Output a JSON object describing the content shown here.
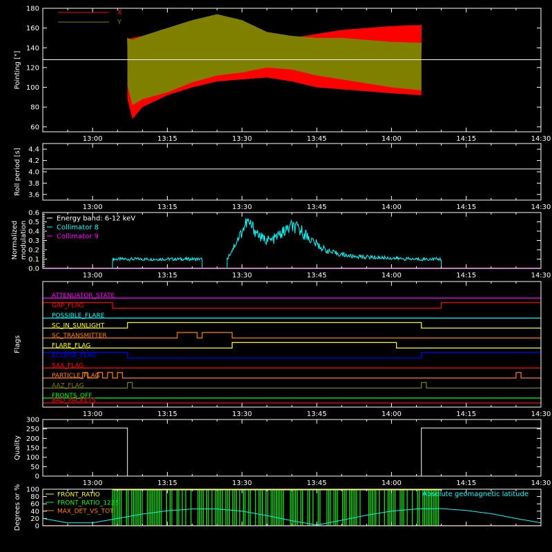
{
  "colors": {
    "background": "#000000",
    "axis": "#ffffff",
    "x_series": "#ff0000",
    "y_series": "#808000",
    "collimator8": "#00ffff",
    "collimator9": "#ff00ff",
    "green": "#00ff00",
    "yellow": "#ffff00",
    "orange": "#ff8000"
  },
  "chart_data": [
    {
      "id": "pointing",
      "type": "line",
      "ylabel": "Pointing [\"]",
      "xlim": [
        "12:50",
        "14:30"
      ],
      "ylim": [
        55,
        180
      ],
      "yticks": [
        60,
        80,
        100,
        120,
        140,
        160,
        180
      ],
      "xticks": [
        "13:00",
        "13:15",
        "13:30",
        "13:45",
        "14:00",
        "14:15",
        "14:30"
      ],
      "legend": [
        "X",
        "Y"
      ],
      "reference_line": 128,
      "series": [
        {
          "name": "X",
          "color": "#ff0000",
          "x": [
            "13:07",
            "13:08",
            "13:10",
            "13:15",
            "13:20",
            "13:25",
            "13:30",
            "13:35",
            "13:40",
            "13:45",
            "13:50",
            "13:55",
            "14:00",
            "14:06"
          ],
          "upper": [
            148,
            150,
            152,
            160,
            165,
            168,
            160,
            152,
            150,
            154,
            158,
            160,
            162,
            163
          ],
          "lower": [
            88,
            68,
            80,
            92,
            100,
            106,
            108,
            110,
            106,
            100,
            98,
            96,
            94,
            92
          ]
        },
        {
          "name": "Y",
          "color": "#808000",
          "x": [
            "13:07",
            "13:08",
            "13:10",
            "13:15",
            "13:20",
            "13:25",
            "13:30",
            "13:35",
            "13:40",
            "13:45",
            "13:50",
            "13:55",
            "14:00",
            "14:06"
          ],
          "upper": [
            150,
            148,
            152,
            160,
            168,
            174,
            168,
            156,
            152,
            150,
            150,
            148,
            146,
            145
          ],
          "lower": [
            102,
            82,
            88,
            95,
            105,
            112,
            115,
            120,
            118,
            112,
            108,
            104,
            100,
            97
          ]
        }
      ]
    },
    {
      "id": "roll",
      "type": "line",
      "ylabel": "Roll period [s]",
      "ylim": [
        3.5,
        4.5
      ],
      "yticks": [
        3.6,
        3.8,
        4.0,
        4.2,
        4.4
      ],
      "yticklabels": [
        "3.6",
        "3.8",
        "4.0",
        "4.2",
        "4.4"
      ],
      "xticks": [
        "13:00",
        "13:15",
        "13:30",
        "13:45",
        "14:00",
        "14:15",
        "14:30"
      ],
      "series": [
        {
          "x": [
            "12:50",
            "14:30"
          ],
          "values": [
            4.05,
            4.05
          ]
        }
      ]
    },
    {
      "id": "modulation",
      "type": "line",
      "ylabel": "Normalized modulation",
      "ylim": [
        0,
        0.6
      ],
      "yticks": [
        0.0,
        0.1,
        0.2,
        0.3,
        0.4,
        0.5,
        0.6
      ],
      "yticklabels": [
        "0.0",
        "0.1",
        "0.2",
        "0.3",
        "0.4",
        "0.5",
        "0.6"
      ],
      "xticks": [
        "13:00",
        "13:15",
        "13:30",
        "13:45",
        "14:00",
        "14:15",
        "14:30"
      ],
      "legend": [
        "Energy band: 6-12 keV",
        "Collimator 8",
        "Collimator 9"
      ],
      "series": [
        {
          "name": "Collimator 8",
          "color": "#00ffff",
          "segments": [
            {
              "x": [
                "13:04",
                "13:06",
                "13:10",
                "13:14",
                "13:18",
                "13:22"
              ],
              "values": [
                0.1,
                0.1,
                0.1,
                0.1,
                0.1,
                0.1
              ]
            },
            {
              "x": [
                "13:27",
                "13:28",
                "13:30",
                "13:31",
                "13:32",
                "13:34",
                "13:36",
                "13:38",
                "13:40",
                "13:42",
                "13:44",
                "13:46",
                "13:48",
                "13:52",
                "13:56",
                "14:00",
                "14:04",
                "14:08",
                "14:10"
              ],
              "values": [
                0.1,
                0.2,
                0.4,
                0.5,
                0.45,
                0.32,
                0.3,
                0.38,
                0.45,
                0.4,
                0.3,
                0.22,
                0.17,
                0.13,
                0.12,
                0.11,
                0.1,
                0.1,
                0.1
              ]
            }
          ]
        },
        {
          "name": "Collimator 9",
          "color": "#ff00ff",
          "segments": [
            {
              "x": [
                "12:50",
                "14:30"
              ],
              "values": [
                0.0,
                0.0
              ]
            }
          ]
        }
      ]
    },
    {
      "id": "flags",
      "type": "line",
      "ylabel": "Flags",
      "xticks": [
        "13:00",
        "13:15",
        "13:30",
        "13:45",
        "14:00",
        "14:15",
        "14:30"
      ],
      "flags": [
        {
          "name": "ATTENUATOR_STATE",
          "color": "#ff00ff",
          "on": []
        },
        {
          "name": "GAP_FLAG",
          "color": "#ff0000",
          "on": [
            [
              "12:50",
              "13:04"
            ],
            [
              "14:10",
              "14:30"
            ]
          ]
        },
        {
          "name": "POSSIBLE_FLARE",
          "color": "#00ffff",
          "on": []
        },
        {
          "name": "SC_IN_SUNLIGHT",
          "color": "#ffff00",
          "on": [
            [
              "13:07",
              "14:06"
            ]
          ]
        },
        {
          "name": "SC_TRANSMITTER",
          "color": "#ff8000",
          "on": [
            [
              "13:17",
              "13:21"
            ],
            [
              "13:22",
              "13:28"
            ]
          ]
        },
        {
          "name": "FLARE_FLAG",
          "color": "#ffff00",
          "on": [
            [
              "13:28",
              "14:01"
            ]
          ]
        },
        {
          "name": "ECLIPSE_FLAG",
          "color": "#0000ff",
          "on": [
            [
              "12:50",
              "13:07"
            ],
            [
              "14:06",
              "14:30"
            ]
          ]
        },
        {
          "name": "SAA_FLAG",
          "color": "#ff0000",
          "on": []
        },
        {
          "name": "PARTICLE_FLAG",
          "color": "#ff8000",
          "on": [
            [
              "12:58",
              "12:59"
            ],
            [
              "13:01",
              "13:02"
            ],
            [
              "13:03",
              "13:04"
            ],
            [
              "13:05",
              "13:06"
            ],
            [
              "14:25",
              "14:26"
            ]
          ]
        },
        {
          "name": "AAZ_FLAG",
          "color": "#808000",
          "on": [
            [
              "13:07",
              "13:08"
            ],
            [
              "14:06",
              "14:07"
            ]
          ]
        },
        {
          "name": "FRONTS_OFF",
          "color": "#00ff00",
          "on": []
        },
        {
          "name": "BAD_PACKETS",
          "color": "#ff0000",
          "on": []
        }
      ]
    },
    {
      "id": "quality",
      "type": "line",
      "ylabel": "Quality",
      "ylim": [
        0,
        300
      ],
      "yticks": [
        0,
        50,
        100,
        150,
        200,
        250,
        300
      ],
      "xticks": [
        "13:00",
        "13:15",
        "13:30",
        "13:45",
        "14:00",
        "14:15",
        "14:30"
      ],
      "series": [
        {
          "x": [
            "12:50",
            "13:07",
            "13:07",
            "14:06",
            "14:06",
            "14:30"
          ],
          "values": [
            255,
            255,
            0,
            0,
            255,
            255
          ]
        }
      ]
    },
    {
      "id": "front_ratio",
      "type": "area",
      "ylabel": "Degrees or %",
      "ylim": [
        0,
        100
      ],
      "yticks": [
        0,
        20,
        40,
        60,
        80,
        100
      ],
      "legend": [
        "FRONT_RATIO",
        "FRONT_RATIO_1225",
        "MAX_DET_VS_TOT"
      ],
      "annotation": "Absolute geomagnetic latitude",
      "series": [
        {
          "name": "FRONT_RATIO",
          "color": "#ffff00"
        },
        {
          "name": "FRONT_RATIO_1225",
          "color": "#00ff00",
          "x_range": [
            "13:04",
            "14:10"
          ],
          "level": 100
        },
        {
          "name": "MAX_DET_VS_TOT",
          "color": "#ff8000"
        },
        {
          "name": "Absolute geomagnetic latitude",
          "color": "#00ffff",
          "x": [
            "12:50",
            "12:55",
            "13:00",
            "13:05",
            "13:10",
            "13:15",
            "13:20",
            "13:25",
            "13:30",
            "13:35",
            "13:40",
            "13:45",
            "13:50",
            "13:55",
            "14:00",
            "14:05",
            "14:10",
            "14:15",
            "14:20",
            "14:25",
            "14:30"
          ],
          "values": [
            20,
            8,
            8,
            20,
            32,
            41,
            46,
            46,
            40,
            28,
            14,
            2,
            15,
            29,
            40,
            46,
            47,
            42,
            33,
            20,
            8
          ]
        }
      ]
    }
  ]
}
